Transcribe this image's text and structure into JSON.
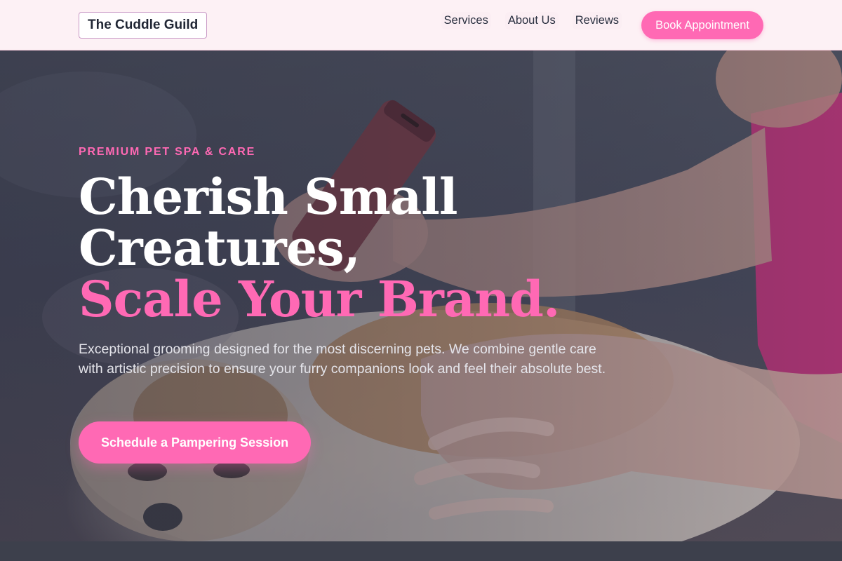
{
  "brand": {
    "name": "The Cuddle Guild",
    "accent_color": "#ff69b4"
  },
  "nav": {
    "links": [
      "Services",
      "About Us",
      "Reviews"
    ],
    "cta_label": "Book Appointment"
  },
  "hero": {
    "eyebrow": "PREMIUM PET SPA & CARE",
    "headline_lines": [
      "Cherish Small",
      "Creatures,"
    ],
    "headline_accent": "Scale Your Brand.",
    "description": "Exceptional grooming designed for the most discerning pets. We combine gentle care with artistic precision to ensure your furry companions look and feel their absolute best.",
    "cta_label": "Schedule a Pampering Session",
    "background_image": "pet-grooming-photo"
  }
}
